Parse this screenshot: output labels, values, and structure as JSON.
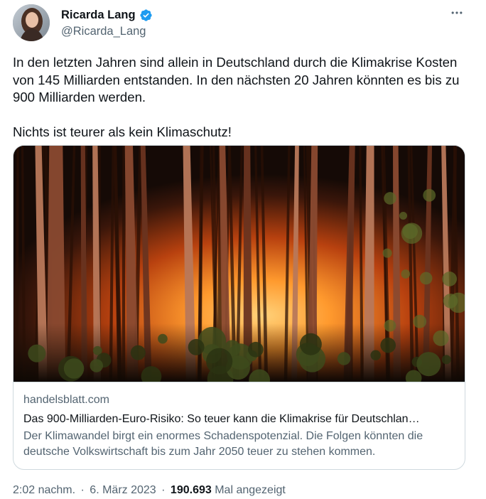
{
  "author": {
    "display_name": "Ricarda Lang",
    "handle": "@Ricarda_Lang",
    "verified": true,
    "verified_color": "#1d9bf0"
  },
  "tweet": {
    "paragraph_1": "In den letzten Jahren sind allein in Deutschland durch die Klimakrise Kosten von 145 Milliarden entstanden. In den nächsten 20 Jahren könnten es bis zu 900 Milliarden werden.",
    "paragraph_2": "Nichts ist teurer als kein Klimaschutz!"
  },
  "card": {
    "domain": "handelsblatt.com",
    "title": "Das 900-Milliarden-Euro-Risiko: So teuer kann die Klimakrise für Deutschlan…",
    "description": "Der Klimawandel birgt ein enormes Schadenspotenzial. Die Folgen könnten die deutsche Volkswirtschaft bis zum Jahr 2050 teuer zu stehen kommen."
  },
  "meta": {
    "time": "2:02 nachm.",
    "date": "6. März 2023",
    "views_count": "190.693",
    "views_label": "Mal angezeigt",
    "separator": "·"
  },
  "icons": {
    "more": "more-horizontal-icon",
    "verified": "verified-badge-icon"
  },
  "colors": {
    "text_primary": "#0f1419",
    "text_secondary": "#536471",
    "border": "#cfd9de"
  }
}
